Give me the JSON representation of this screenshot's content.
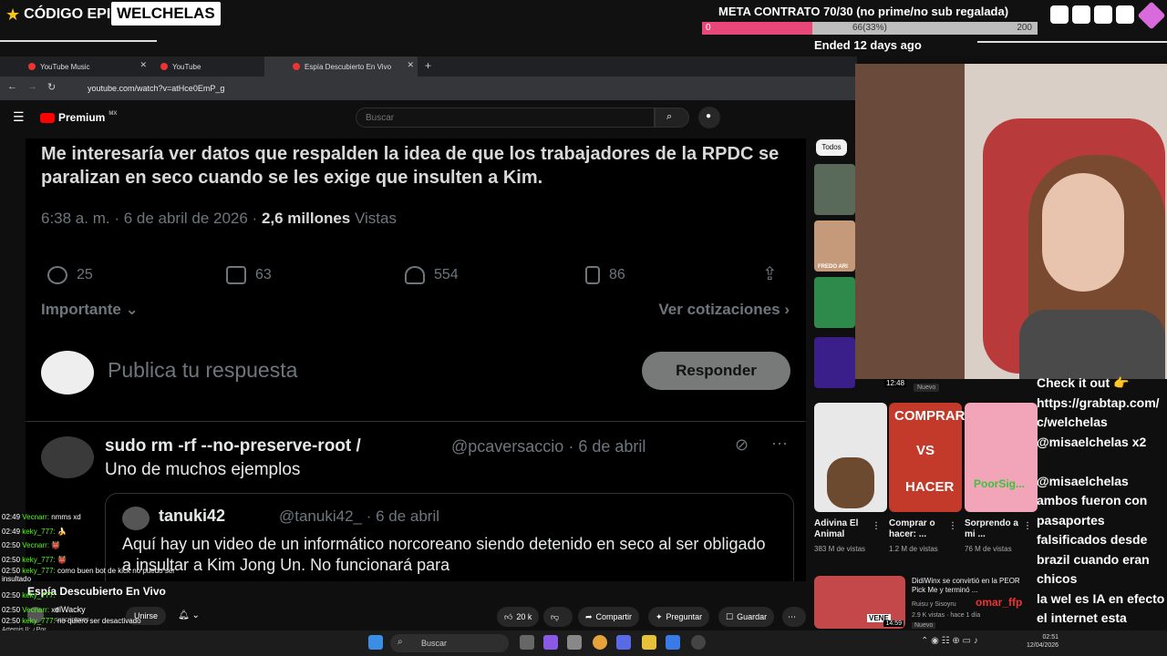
{
  "overlay": {
    "code_epic": "CÓDIGO EPIC",
    "badge": "WELCHELAS",
    "meta_title": "META CONTRATO 70/30 (no prime/no sub regalada)",
    "meta_start": "0",
    "meta_progress": "66(33%)",
    "meta_end": "200",
    "meta_fraction": 0.33,
    "ended": "Ended 12 days ago"
  },
  "browser": {
    "tabs": [
      {
        "label": "YouTube Music"
      },
      {
        "label": "YouTube"
      },
      {
        "label": "Espía Descubierto En Vivo"
      }
    ],
    "url": "youtube.com/watch?v=atHce0EmP_g"
  },
  "youtube": {
    "brand": "Premium",
    "region": "MX",
    "search_placeholder": "Buscar"
  },
  "video": {
    "tweet_body": "Me interesaría ver datos que respalden la idea de que los trabajadores de la RPDC se paralizan en seco cuando se les exige que insulten a Kim.",
    "tweet_time": "6:38 a. m. · 6 de abril de 2026 ·",
    "tweet_views": "2,6 millones",
    "tweet_views_label": "Vistas",
    "replies": "25",
    "retweets": "63",
    "likes": "554",
    "bookmarks": "86",
    "importante": "Importante ⌄",
    "cotizaciones": "Ver cotizaciones ›",
    "reply_placeholder": "Publica tu respuesta",
    "reply_button": "Responder",
    "t2_name": "sudo rm -rf --no-preserve-root /",
    "t2_handle": "@pcaversaccio · 6 de abril",
    "t2_text": "Uno de muchos ejemplos",
    "q_name": "tanuki42",
    "q_handle": "@tanuki42_ · 6 de abril",
    "q_text": "Aquí hay un video de un informático norcoreano siendo detenido en seco al ser obligado a insultar a Kim Jong Un. No funcionará para"
  },
  "below": {
    "title": "Espía Descubierto En Vivo",
    "channel": "elWacky",
    "subs": "suscriptores",
    "join": "Unirse",
    "likes": "20 k",
    "share": "Compartir",
    "ask": "Preguntar",
    "save": "Guardar"
  },
  "sidebar": {
    "chip": "Todos",
    "thumb_duration": "12:48",
    "nuevo": "Nuevo",
    "thumb_fredo": "FREDO ARI",
    "videos": [
      {
        "title": "Adivina El Animal",
        "views": "383 M de vistas"
      },
      {
        "title": "Comprar o hacer: ...",
        "views": "1.2 M de vistas",
        "overlay_top": "COMPRAR",
        "overlay_vs": "VS",
        "overlay_bottom": "HACER"
      },
      {
        "title": "Sorprendo a mi ...",
        "views": "76 M de vistas",
        "overlay": "PoorSig..."
      }
    ],
    "bottom": {
      "title": "DidiWinx se convirtió en la PEOR Pick Me y terminó ...",
      "channel": "Ruisu y Sisoyru",
      "meta": "2.9 K vistas · hace 1 día",
      "badge": "Nuevo",
      "thumb_text": "VENE",
      "duration": "14:59"
    }
  },
  "chat_right": [
    "Check it out 👉",
    "https://grabtap.com/",
    "c/welchelas",
    "@misaelchelas x2",
    "",
    "@misaelchelas",
    "ambos fueron con",
    "pasaportes",
    "falsificados desde",
    "brazil cuando eran",
    "chicos",
    "la wel es IA en efecto",
    "el internet esta",
    "muerto"
  ],
  "chat_left": [
    {
      "t": "02:49",
      "u": "Vecnarr:",
      "m": "nmms xd"
    },
    {
      "t": "02:49",
      "u": "keky_777:",
      "m": "🍌"
    },
    {
      "t": "02:50",
      "u": "Vecnarr:",
      "m": "👹"
    },
    {
      "t": "02:50",
      "u": "keky_777:",
      "m": "👹"
    },
    {
      "t": "02:50",
      "u": "keky_777:",
      "m": "como buen bot de kick no puedo ser insultado"
    },
    {
      "t": "02:50",
      "u": "keky_777:",
      "m": ""
    },
    {
      "t": "02:50",
      "u": "Vecnarr:",
      "m": "xd"
    },
    {
      "t": "02:50",
      "u": "keky_777:",
      "m": "no quiero ser desactivado"
    },
    {
      "t": "",
      "u": "Artemis II:",
      "m": "¿Por..."
    }
  ],
  "chat_left_name": "omar_ffp",
  "taskbar": {
    "search": "Buscar",
    "time": "02:51",
    "date": "12/04/2026"
  }
}
